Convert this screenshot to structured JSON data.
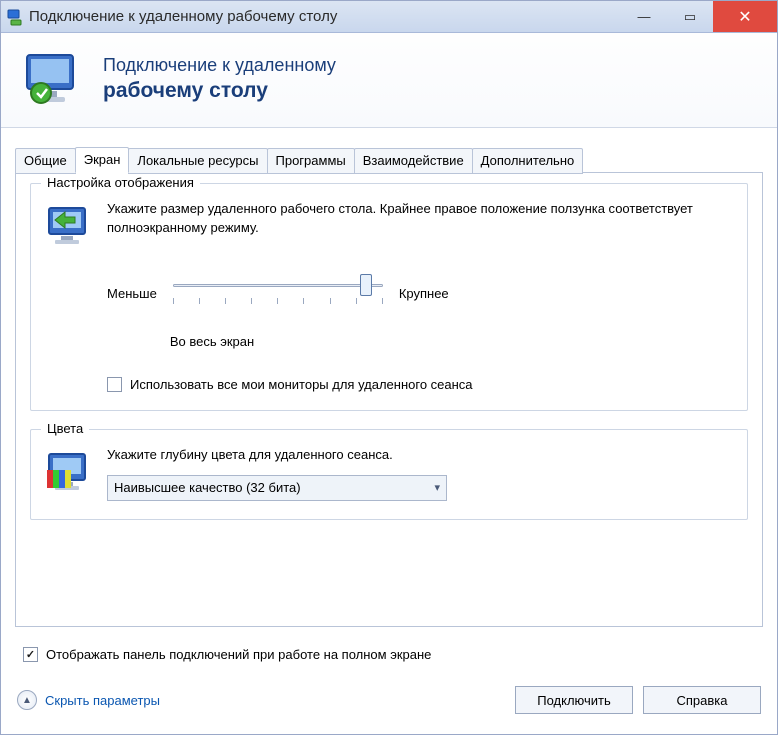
{
  "titlebar": {
    "title": "Подключение к удаленному рабочему столу"
  },
  "header": {
    "line1": "Подключение к удаленному",
    "line2": "рабочему столу"
  },
  "tabs": [
    {
      "label": "Общие",
      "active": false
    },
    {
      "label": "Экран",
      "active": true
    },
    {
      "label": "Локальные ресурсы",
      "active": false
    },
    {
      "label": "Программы",
      "active": false
    },
    {
      "label": "Взаимодействие",
      "active": false
    },
    {
      "label": "Дополнительно",
      "active": false
    }
  ],
  "display_group": {
    "legend": "Настройка отображения",
    "description": "Укажите размер удаленного рабочего стола. Крайнее правое положение ползунка соответствует полноэкранному режиму.",
    "slider_min_label": "Меньше",
    "slider_max_label": "Крупнее",
    "slider_value_label": "Во весь экран",
    "slider_position_pct": 92,
    "multimon_checkbox_label": "Использовать все мои мониторы для удаленного сеанса",
    "multimon_checked": false
  },
  "color_group": {
    "legend": "Цвета",
    "description": "Укажите глубину цвета для удаленного сеанса.",
    "combo_selected": "Наивысшее качество (32 бита)"
  },
  "fullscreen_bar_checkbox": {
    "label": "Отображать панель подключений при работе на полном экране",
    "checked": true
  },
  "footer": {
    "toggle_label": "Скрыть параметры",
    "connect_label": "Подключить",
    "help_label": "Справка"
  }
}
